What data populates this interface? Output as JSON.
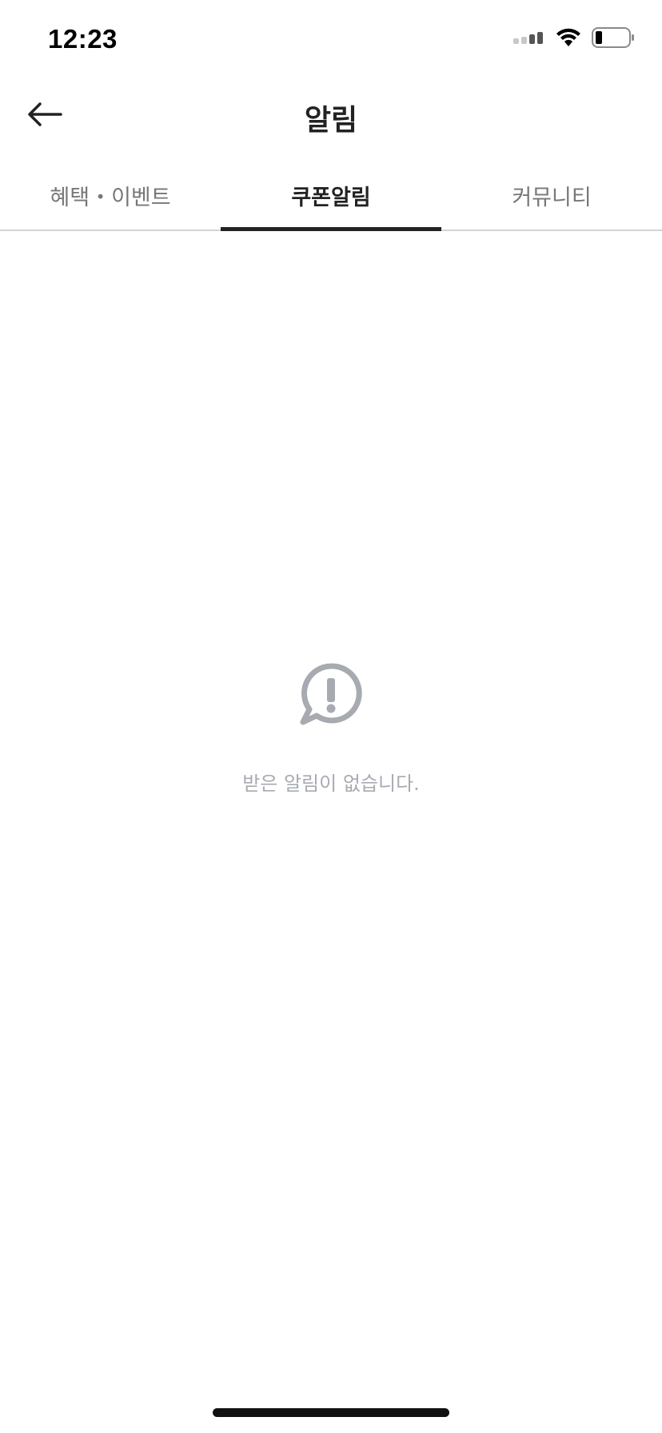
{
  "status_bar": {
    "time": "12:23"
  },
  "header": {
    "title": "알림",
    "back_icon": "arrow-left-icon"
  },
  "tabs": [
    {
      "label": "혜택・이벤트",
      "active": false
    },
    {
      "label": "쿠폰알림",
      "active": true
    },
    {
      "label": "커뮤니티",
      "active": false
    }
  ],
  "empty_state": {
    "icon": "alert-speech-bubble-icon",
    "message": "받은 알림이 없습니다."
  },
  "colors": {
    "text_primary": "#222222",
    "text_secondary": "#777777",
    "empty_gray": "#a7abb1",
    "divider": "#d4d4d4"
  }
}
